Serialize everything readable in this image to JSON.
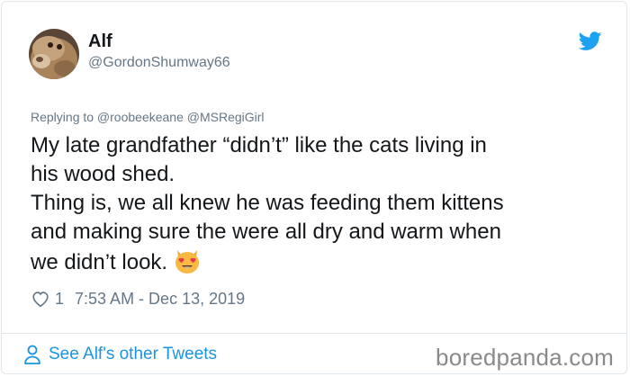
{
  "author": {
    "name": "Alf",
    "handle": "@GordonShumway66",
    "avatar_icon": "alf-avatar"
  },
  "reply_line": "Replying to @roobeekeane @MSRegiGirl",
  "tweet_lines": [
    "My late grandfather “didn’t” like the cats living in",
    "his wood shed.",
    "Thing is, we all knew he was feeding them kittens",
    "and making sure the were all dry and warm when",
    "we didn’t look."
  ],
  "emoji": "smiling-cat-heart-eyes",
  "meta": {
    "likes": "1",
    "timestamp": "7:53 AM - Dec 13, 2019"
  },
  "footer": {
    "link_text": "See Alf's other Tweets"
  },
  "watermark": "boredpanda.com",
  "colors": {
    "twitter_blue": "#1da1f2",
    "link_blue": "#1b95e0",
    "muted_gray": "#657786",
    "border": "#e1e8ed"
  }
}
